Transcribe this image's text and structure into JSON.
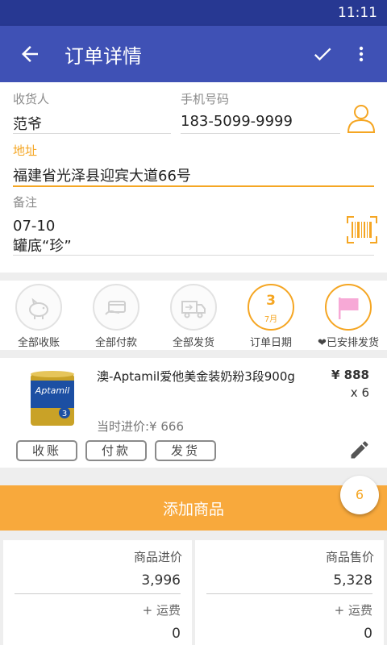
{
  "status_bar": {
    "time": "11:11"
  },
  "app_bar": {
    "title": "订单详情",
    "back_icon": "arrow-back-icon",
    "confirm_icon": "check-icon",
    "more_icon": "more-vert-icon"
  },
  "form": {
    "recipient_label": "收货人",
    "recipient_value": "范爷",
    "phone_label": "手机号码",
    "phone_value": "183-5099-9999",
    "address_label": "地址",
    "address_value": "福建省光泽县迎宾大道66号",
    "note_label": "备注",
    "note_line1": "07-10",
    "note_line2": "罐底“珍”"
  },
  "shortcuts": [
    {
      "label": "全部收账",
      "icon": "piggy-bank-icon"
    },
    {
      "label": "全部付款",
      "icon": "card-payment-icon"
    },
    {
      "label": "全部发货",
      "icon": "delivery-truck-icon"
    },
    {
      "label": "订单日期",
      "icon": "calendar-date-icon",
      "day": "3",
      "month": "7月"
    },
    {
      "label": "已安排发货",
      "icon": "flag-icon",
      "prefix": "❤"
    }
  ],
  "item": {
    "name": "澳-Aptamil爱他美金装奶粉3段900g",
    "price": "¥ 888",
    "quantity": "x 6",
    "cost": "当时进价:¥ 666",
    "image_text": "Aptamil",
    "buttons": {
      "collect": "收账",
      "pay": "付款",
      "ship": "发货"
    }
  },
  "add_button": {
    "label": "添加商品",
    "count": "6"
  },
  "summary": {
    "cost_label": "商品进价",
    "cost_value": "3,996",
    "cost_fee_label": "+ 运费",
    "cost_fee_value": "0",
    "sale_label": "商品售价",
    "sale_value": "5,328",
    "sale_fee_label": "+ 运费",
    "sale_fee_value": "0"
  },
  "colors": {
    "primary": "#3f51b5",
    "status_bar": "#273892",
    "accent": "#f5a623",
    "add_bar": "#f8a93c",
    "flag": "#f7a9d6"
  }
}
